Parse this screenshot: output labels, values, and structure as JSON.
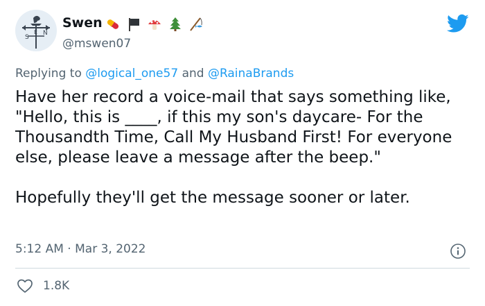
{
  "author": {
    "display_name": "Swen",
    "handle": "@mswen07",
    "avatar_letters": "S E N",
    "emojis": [
      "pill-icon",
      "black-flag-icon",
      "mushroom-icon",
      "christmas-tree-icon",
      "fishing-pole-icon"
    ]
  },
  "reply": {
    "prefix": "Replying to",
    "mention_1": "@logical_one57",
    "joiner": "and",
    "mention_2": "@RainaBrands"
  },
  "tweet": {
    "text": "Have her record a voice-mail that says something like, \"Hello, this is ____, if this my son's daycare- For the Thousandth Time, Call My Husband First! For everyone else, please leave a message after the beep.\"\n\nHopefully they'll get the message sooner or later."
  },
  "meta": {
    "time": "5:12 AM",
    "separator": "·",
    "date": "Mar 3, 2022"
  },
  "stats": {
    "likes": "1.8K"
  },
  "colors": {
    "accent": "#1d9bf0",
    "secondary_text": "#536471",
    "primary_text": "#0f1419"
  }
}
